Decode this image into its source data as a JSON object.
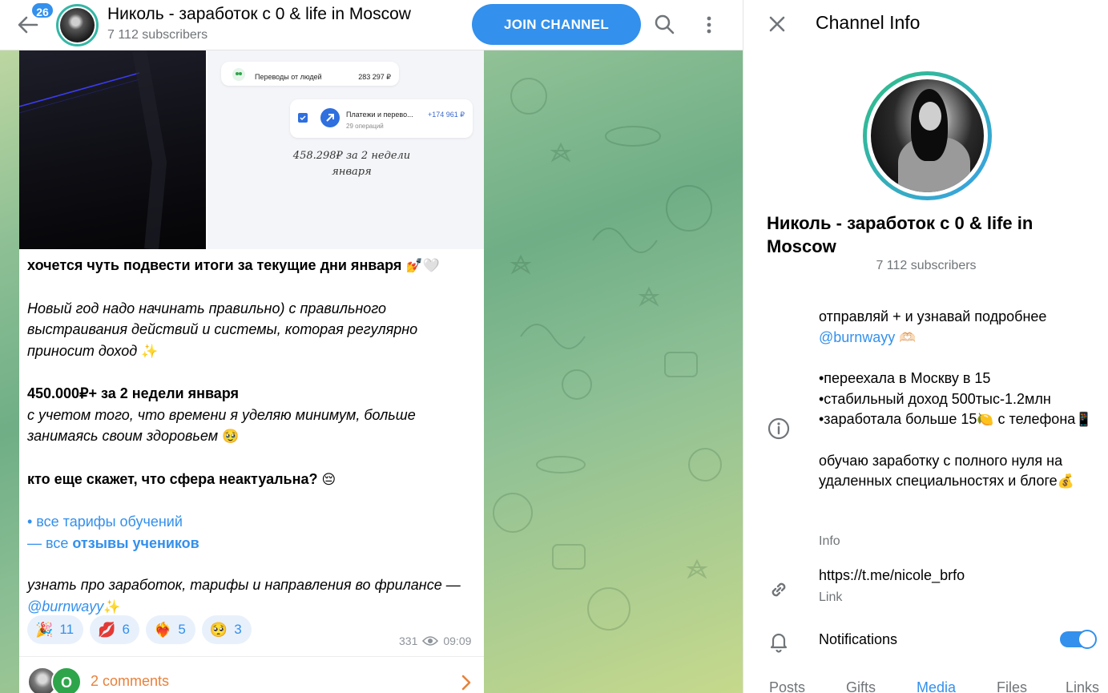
{
  "header": {
    "unread_count": "26",
    "channel_title": "Николь - заработок с 0 & life in Moscow",
    "subscribers": "7 112 subscribers",
    "join_label": "JOIN CHANNEL"
  },
  "post": {
    "screenshot": {
      "row1_label": "Переводы от людей",
      "row1_amount": "283 297 ₽",
      "row2_label": "Платежи и перево...",
      "row2_sub": "29 операций",
      "row2_amount": "+174 961 ₽",
      "caption": "458.298₽ за 2 недели января"
    },
    "lines": {
      "l1": "хочется чуть подвести итоги за текущие дни января",
      "l1_emoji": "💅🤍",
      "l2": "Новый год надо начинать правильно) с правильного выстраивания действий и системы, которая регулярно приносит доход",
      "l2_emoji": "✨",
      "l3": "450.000₽+ за 2 недели января",
      "l4": "с учетом того, что времени я уделяю минимум, больше занимаясь своим здоровьем",
      "l4_emoji": "🥹",
      "l5": "кто еще скажет, что сфера неактуальна?",
      "l5_emoji": "😔",
      "l6": "• все тарифы обучений",
      "l7a": "— все ",
      "l7b": "отзывы учеников",
      "l8a": "узнать про заработок, тарифы и направления во фрилансе — ",
      "l8_link": "@burnwayy",
      "l8_emoji": "✨"
    },
    "reactions": [
      {
        "emoji": "🎉",
        "count": "11"
      },
      {
        "emoji": "💋",
        "count": "6"
      },
      {
        "emoji": "❤️‍🔥",
        "count": "5"
      },
      {
        "emoji": "🥺",
        "count": "3"
      }
    ],
    "views": "331",
    "time": "09:09",
    "comments_label": "2 comments",
    "commenter_initial": "O"
  },
  "info_panel": {
    "title": "Channel Info",
    "name": "Николь - заработок с 0 & life in Moscow",
    "subscribers": "7 112 subscribers",
    "description": {
      "d1": "отправляй + и узнавай подробнее",
      "d1_link": "@burnwayy",
      "d1_emoji": "🫶🏻",
      "d2": "•переехала в Москву в 15",
      "d3": "•стабильный доход 500тыс-1.2млн",
      "d4": "•заработала больше 15",
      "d4_emoji": "🍋",
      "d4b": " с телефона",
      "d4b_emoji": "📱",
      "d5": "обучаю заработку с полного нуля на удаленных специальностях и блоге",
      "d5_emoji": "💰"
    },
    "description_label": "Info",
    "link_value": "https://t.me/nicole_brfo",
    "link_label": "Link",
    "notifications_label": "Notifications",
    "notifications_on": true,
    "tabs": [
      "Posts",
      "Gifts",
      "Media",
      "Files",
      "Links"
    ],
    "active_tab": "Media"
  },
  "colors": {
    "accent": "#3390ec",
    "comments": "#e8813a",
    "avatar_ring": "#34b6a6"
  }
}
